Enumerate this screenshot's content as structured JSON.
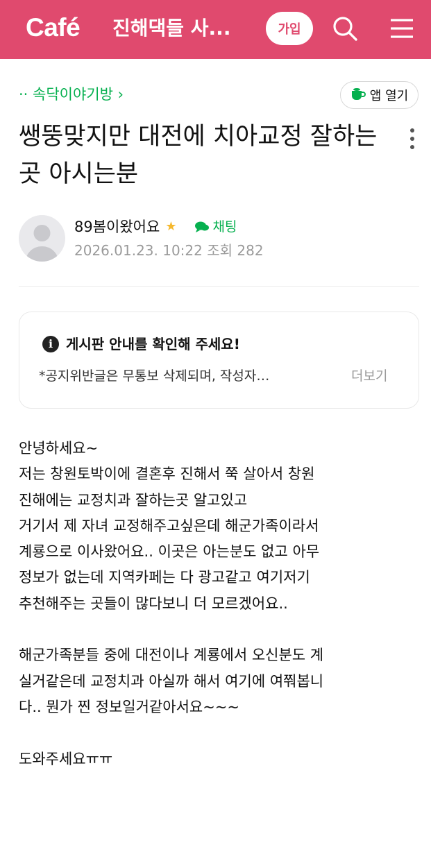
{
  "header": {
    "logo": "Café",
    "cafe_name": "진해댁들 사...",
    "join_label": "가입",
    "search_icon": "search-icon",
    "menu_icon": "hamburger-menu-icon",
    "background_color": "#e04a6e"
  },
  "breadcrumb": {
    "prefix": "··",
    "board": "속닥이야기방",
    "chevron": "›"
  },
  "app_open": {
    "label": "앱 열기",
    "icon": "coffee-cup-icon"
  },
  "post": {
    "title": "쌩뚱맞지만 대전에 치아교정 잘하는곳 아시는분",
    "author": "89봄이왔어요",
    "author_badge": "★",
    "chat_label": "채팅",
    "date": "2026.01.23. 10:22",
    "views_label": "조회",
    "views": "282"
  },
  "notice": {
    "title": "게시판 안내를 확인해 주세요!",
    "body": "*공지위반글은 무통보 삭제되며, 작성자…",
    "more_label": "더보기"
  },
  "content": {
    "lines": [
      "안녕하세요~",
      "저는 창원토박이에 결혼후 진해서 쭉 살아서 창원",
      "진해에는 교정치과 잘하는곳 알고있고",
      "거기서 제 자녀 교정해주고싶은데 해군가족이라서",
      "계룡으로 이사왔어요.. 이곳은 아는분도 없고 아무",
      "정보가 없는데 지역카페는 다 광고같고 여기저기",
      "추천해주는 곳들이 많다보니 더 모르겠어요..",
      "",
      "해군가족분들 중에 대전이나 계룡에서 오신분도 계",
      "실거같은데 교정치과 아실까 해서 여기에 여쭤봅니",
      "다.. 뭔가 찐 정보일거같아서요~~~",
      "",
      "도와주세요ㅠㅠ"
    ]
  }
}
